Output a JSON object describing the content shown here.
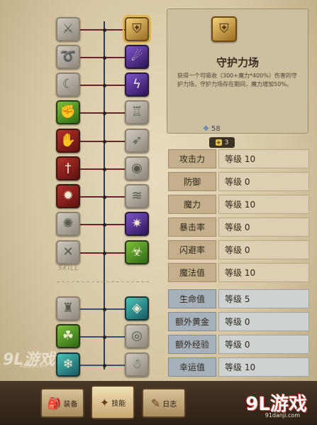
{
  "skill_tree": {
    "divider_label": "SKILL",
    "left_column": [
      {
        "icon": "blade-icon",
        "state": "grey"
      },
      {
        "icon": "swirl-icon",
        "state": "grey"
      },
      {
        "icon": "moon-slash-icon",
        "state": "grey"
      },
      {
        "icon": "arm-flex-icon",
        "state": "green"
      },
      {
        "icon": "fist-icon",
        "state": "red"
      },
      {
        "icon": "sword-strike-icon",
        "state": "red"
      },
      {
        "icon": "bomb-icon",
        "state": "red"
      },
      {
        "icon": "shatter-icon",
        "state": "grey"
      },
      {
        "icon": "cross-swords-icon",
        "state": "grey"
      },
      {
        "icon": "totem-icon",
        "state": "grey"
      },
      {
        "icon": "spirit-icon",
        "state": "green"
      },
      {
        "icon": "dash-icon",
        "state": "blue"
      }
    ],
    "right_column": [
      {
        "icon": "shield-icon",
        "state": "gold",
        "selected": true
      },
      {
        "icon": "dark-slash-icon",
        "state": "purple"
      },
      {
        "icon": "lightning-icon",
        "state": "purple"
      },
      {
        "icon": "armor-icon",
        "state": "grey"
      },
      {
        "icon": "arrow-flight-icon",
        "state": "grey"
      },
      {
        "icon": "eye-icon",
        "state": "grey"
      },
      {
        "icon": "wind-icon",
        "state": "grey"
      },
      {
        "icon": "vortex-icon",
        "state": "purple"
      },
      {
        "icon": "poison-icon",
        "state": "green"
      },
      {
        "icon": "rune-icon",
        "state": "teal"
      },
      {
        "icon": "orb-icon",
        "state": "grey"
      },
      {
        "icon": "ghost-icon",
        "state": "grey"
      }
    ]
  },
  "detail": {
    "icon": "shield-icon",
    "title": "守护力场",
    "description": "获得一个可吸收（300+魔力*400%）伤害的守护力场，守护力场存在期间，魔力增加50%。"
  },
  "points": {
    "gems": "58",
    "plus": "3"
  },
  "stats": [
    {
      "name": "攻击力",
      "level": "等级 10",
      "group": "primary"
    },
    {
      "name": "防御",
      "level": "等级 0",
      "group": "primary"
    },
    {
      "name": "魔力",
      "level": "等级 10",
      "group": "primary"
    },
    {
      "name": "暴击率",
      "level": "等级 0",
      "group": "primary"
    },
    {
      "name": "闪避率",
      "level": "等级 0",
      "group": "primary"
    },
    {
      "name": "魔法值",
      "level": "等级 10",
      "group": "primary"
    },
    {
      "name": "生命值",
      "level": "等级 5",
      "group": "secondary"
    },
    {
      "name": "额外黄金",
      "level": "等级 0",
      "group": "secondary"
    },
    {
      "name": "额外经验",
      "level": "等级 0",
      "group": "secondary"
    },
    {
      "name": "幸运值",
      "level": "等级 10",
      "group": "secondary"
    }
  ],
  "tabs": [
    {
      "label": "装备",
      "icon": "backpack-icon"
    },
    {
      "label": "技能",
      "icon": "skill-book-icon",
      "active": true
    },
    {
      "label": "日志",
      "icon": "journal-icon"
    }
  ],
  "watermarks": {
    "left": "9L游戏",
    "left_sub": "91danji.com",
    "right": "9L游戏",
    "right_sub": "91danji.com"
  }
}
